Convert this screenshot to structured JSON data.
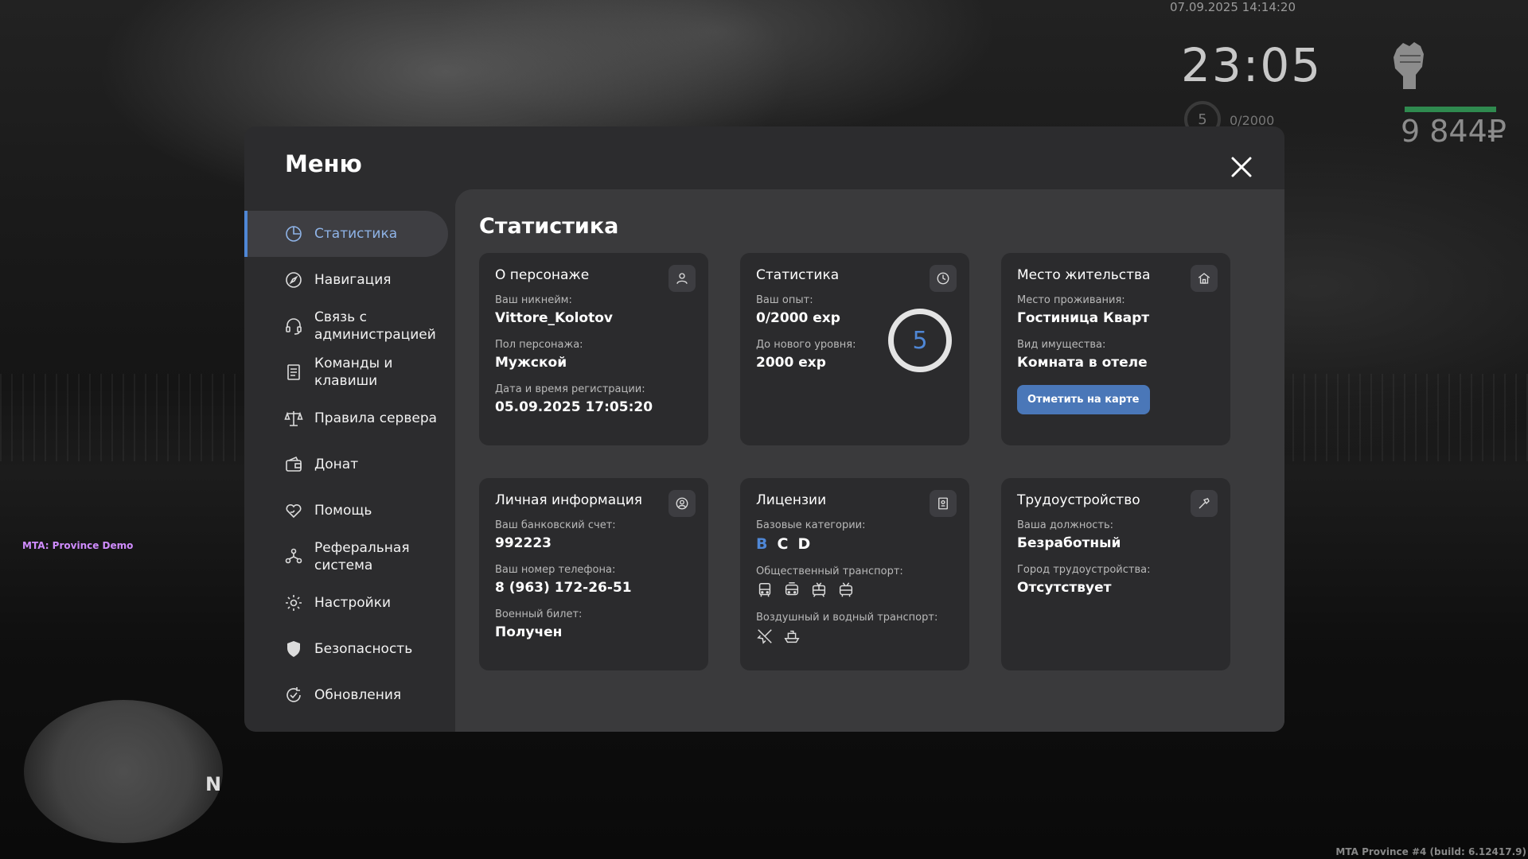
{
  "hud": {
    "datetime": "07.09.2025 14:14:20",
    "time": "23:05",
    "level": "5",
    "exp": "0/2000",
    "money": "9 844₽"
  },
  "overlay": {
    "server_label": "MTA: Province Demo",
    "build_label": "MTA Province #4 (build: 6.12417.9)",
    "minimap_north": "N"
  },
  "menu": {
    "title": "Меню",
    "nav": [
      {
        "label": "Статистика",
        "icon": "pie-chart-icon",
        "active": true
      },
      {
        "label": "Навигация",
        "icon": "compass-icon"
      },
      {
        "label": "Связь с администрацией",
        "icon": "headset-icon"
      },
      {
        "label": "Команды и клавиши",
        "icon": "document-list-icon"
      },
      {
        "label": "Правила сервера",
        "icon": "scales-icon"
      },
      {
        "label": "Донат",
        "icon": "wallet-icon"
      },
      {
        "label": "Помощь",
        "icon": "heart-hand-icon"
      },
      {
        "label": "Реферальная система",
        "icon": "people-network-icon"
      },
      {
        "label": "Настройки",
        "icon": "gear-icon"
      },
      {
        "label": "Безопасность",
        "icon": "shield-icon"
      },
      {
        "label": "Обновления",
        "icon": "refresh-check-icon"
      }
    ]
  },
  "content": {
    "title": "Статистика",
    "character": {
      "title": "О персонаже",
      "nickname_label": "Ваш никнейм:",
      "nickname": "Vittore_Kolotov",
      "gender_label": "Пол персонажа:",
      "gender": "Мужской",
      "reg_label": "Дата и время регистрации:",
      "reg": "05.09.2025 17:05:20"
    },
    "stats": {
      "title": "Статистика",
      "exp_label": "Ваш опыт:",
      "exp": "0/2000 exp",
      "next_label": "До нового уровня:",
      "next": "2000 exp",
      "level": "5"
    },
    "residence": {
      "title": "Место жительства",
      "place_label": "Место проживания:",
      "place": "Гостиница Кварт",
      "type_label": "Вид имущества:",
      "type": "Комната в отеле",
      "button": "Отметить на карте"
    },
    "personal": {
      "title": "Личная информация",
      "bank_label": "Ваш банковский счет:",
      "bank": "992223",
      "phone_label": "Ваш номер телефона:",
      "phone": "8 (963) 172-26-51",
      "military_label": "Военный билет:",
      "military": "Получен"
    },
    "licenses": {
      "title": "Лицензии",
      "base_label": "Базовые категории:",
      "cat_b": "B",
      "cat_c": "C",
      "cat_d": "D",
      "public_label": "Общественный транспорт:",
      "air_label": "Воздушный и водный транспорт:"
    },
    "employment": {
      "title": "Трудоустройство",
      "position_label": "Ваша должность:",
      "position": "Безработный",
      "city_label": "Город трудоустройства:",
      "city": "Отсутствует"
    }
  },
  "colors": {
    "accent": "#4f87d6",
    "button": "#4a77b8",
    "health": "#2f8a4f",
    "modal_bg": "#2c2c2e",
    "content_bg": "#3a3a3c",
    "card_bg": "#2b2b2d"
  }
}
